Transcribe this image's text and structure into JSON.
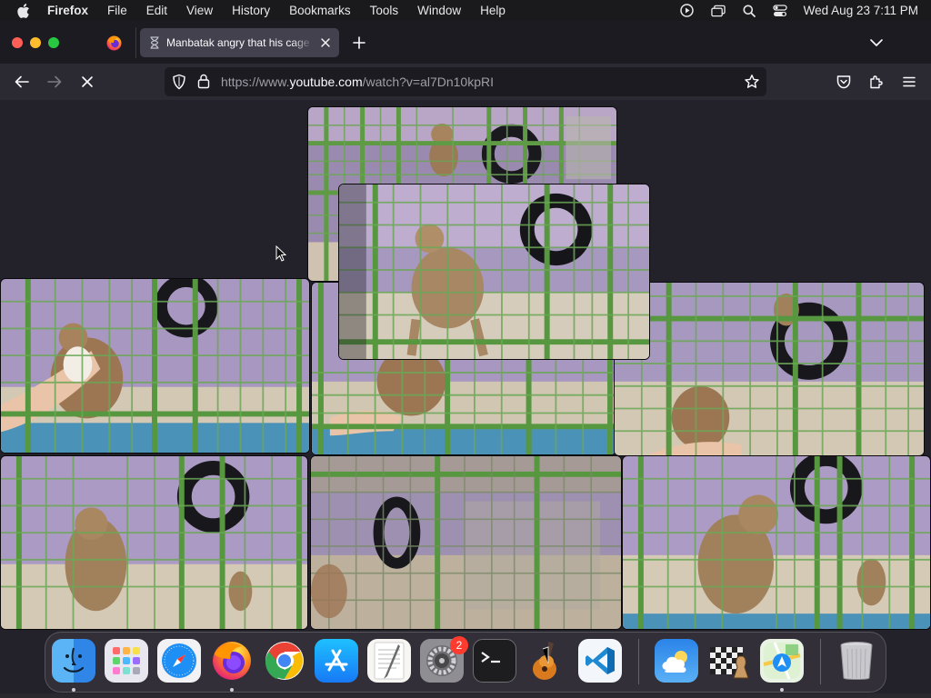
{
  "menubar": {
    "apple_icon": "apple-logo",
    "app_name": "Firefox",
    "items": [
      "File",
      "Edit",
      "View",
      "History",
      "Bookmarks",
      "Tools",
      "Window",
      "Help"
    ],
    "status_icons": [
      "screen-record-icon",
      "screen-mirroring-icon",
      "spotlight-search-icon",
      "control-center-icon"
    ],
    "clock": "Wed Aug 23  7:11 PM"
  },
  "browser": {
    "tab": {
      "title": "Manbatak angry that his cage is",
      "icon": "hourglass-loading-icon"
    },
    "url": {
      "prefix": "https://www.",
      "host": "youtube.com",
      "path": "/watch?v=al7Dn10kpRI"
    },
    "colors": {
      "toolbar": "#2b2a33",
      "tab_active": "#42414d",
      "url_bg": "#1c1b22"
    }
  },
  "content": {
    "description_type": "video-thumbnail-collage",
    "thumbnails": [
      {
        "scene": "monkey-on-tire-top"
      },
      {
        "scene": "monkey-standing-front"
      },
      {
        "scene": "monkey-with-hand-left"
      },
      {
        "scene": "monkey-reaching-hand-center"
      },
      {
        "scene": "monkey-on-tire-right"
      },
      {
        "scene": "monkey-sitting-left"
      },
      {
        "scene": "empty-cage-center"
      },
      {
        "scene": "two-monkeys-right"
      }
    ]
  },
  "dock": {
    "apps": [
      {
        "name": "Finder",
        "running": true
      },
      {
        "name": "Launchpad",
        "running": false
      },
      {
        "name": "Safari",
        "running": false
      },
      {
        "name": "Firefox",
        "running": true
      },
      {
        "name": "Google Chrome",
        "running": false
      },
      {
        "name": "App Store",
        "running": false
      },
      {
        "name": "TextEdit",
        "running": false
      },
      {
        "name": "System Settings",
        "running": false,
        "badge": "2"
      },
      {
        "name": "Terminal",
        "running": false
      },
      {
        "name": "Instruments",
        "running": false
      },
      {
        "name": "Visual Studio Code",
        "running": false
      },
      {
        "name": "Weather",
        "running": false
      },
      {
        "name": "Chess",
        "running": false
      },
      {
        "name": "Maps",
        "running": true
      },
      {
        "name": "Trash",
        "running": false
      }
    ]
  }
}
